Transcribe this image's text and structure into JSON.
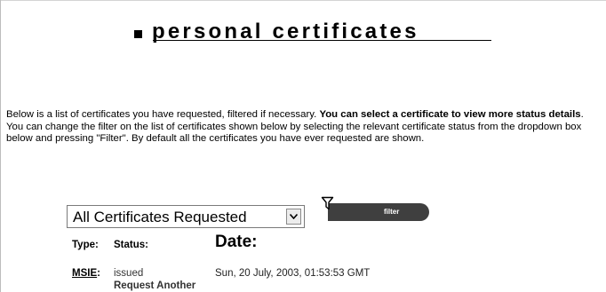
{
  "page": {
    "title": "personal certificates"
  },
  "intro": {
    "text_before": "Below is a list of certificates you have requested, filtered if necessary. ",
    "text_bold": "You can select a certificate to view more status details",
    "text_after": ". You can change the filter on the list of certificates shown below by selecting the relevant certificate status from the dropdown box below and pressing \"Filter\". By default all the certificates you have ever requested are shown."
  },
  "filter": {
    "selected_value": "All Certificates Requested",
    "button_label": "filter",
    "button_color": "#3f3f3f"
  },
  "table": {
    "headers": {
      "type": "Type:",
      "status": "Status:",
      "date": "Date:"
    },
    "rows": [
      {
        "type": "MSIE",
        "type_suffix": ":",
        "status": "issued",
        "action": "Request Another",
        "date": "Sun, 20 July, 2003, 01:53:53 GMT"
      }
    ]
  }
}
